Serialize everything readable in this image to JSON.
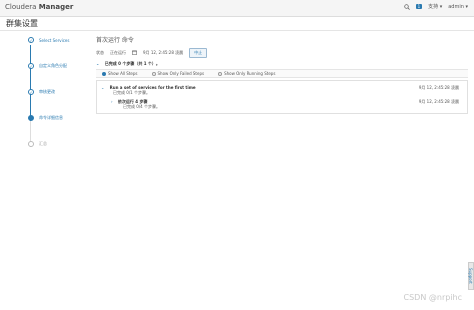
{
  "app": {
    "brand_prefix": "Cloudera ",
    "brand_name": "Manager"
  },
  "topbar": {
    "badge": "1",
    "user_menu": "支持 ▾",
    "admin_menu": "admin ▾"
  },
  "page": {
    "title": "群集设置"
  },
  "steps": [
    {
      "label": "Select Services",
      "state": "done"
    },
    {
      "label": "自定义角色分配",
      "state": "done"
    },
    {
      "label": "审核更改",
      "state": "done"
    },
    {
      "label": "命令详细信息",
      "state": "current"
    },
    {
      "label": "汇总",
      "state": "todo"
    }
  ],
  "command": {
    "title": "首次运行 命令",
    "status_label": "状态",
    "status_value": "正在运行",
    "date": "9月 12, 2:45:28 凌晨",
    "stop_label": "中止",
    "summary": "已完成 0 个步骤（共 1 个）。"
  },
  "filters": [
    {
      "label": "Show All Steps",
      "selected": true
    },
    {
      "label": "Show Only Failed Steps",
      "selected": false
    },
    {
      "label": "Show Only Running Steps",
      "selected": false
    }
  ],
  "rows": [
    {
      "title": "Run a set of services for the first time",
      "sub": "已完成 0/1 个步骤。",
      "time": "9月 12, 2:45:28 凌晨"
    },
    {
      "title": "依次运行 4 步骤",
      "sub": "已完成 0/4 个步骤。",
      "time": "9月 12, 2:45:28 凌晨"
    }
  ],
  "help_tab": "Support",
  "watermark": "CSDN @nrpihc"
}
